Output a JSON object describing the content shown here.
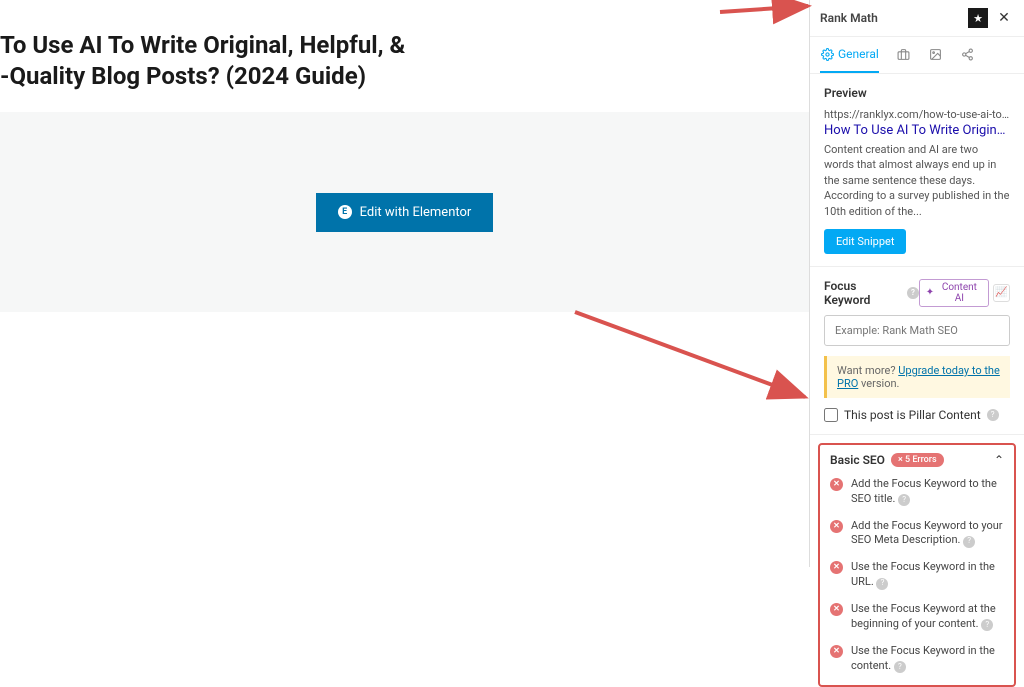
{
  "main": {
    "title_line1": "To Use AI To Write Original, Helpful, &",
    "title_line2": "-Quality Blog Posts? (2024 Guide)",
    "elementor_button": "Edit with Elementor"
  },
  "sidebar": {
    "plugin_name": "Rank Math",
    "tabs": {
      "general": "General"
    },
    "preview": {
      "heading": "Preview",
      "url": "https://ranklyx.com/how-to-use-ai-to-writ...",
      "title": "How To Use AI To Write Original, H...",
      "description": "Content creation and AI are two words that almost always end up in the same sentence these days. According to a survey published in the 10th edition of the...",
      "edit_button": "Edit Snippet"
    },
    "focus_keyword": {
      "label": "Focus Keyword",
      "content_ai": "Content AI",
      "placeholder": "Example: Rank Math SEO"
    },
    "upgrade": {
      "prefix": "Want more? ",
      "link": "Upgrade today to the PRO",
      "suffix": " version."
    },
    "pillar": {
      "label": "This post is Pillar Content"
    },
    "basic_seo": {
      "title": "Basic SEO",
      "error_badge": "× 5 Errors",
      "errors": [
        "Add the Focus Keyword to the SEO title.",
        "Add the Focus Keyword to your SEO Meta Description.",
        "Use the Focus Keyword in the URL.",
        "Use the Focus Keyword at the beginning of your content.",
        "Use the Focus Keyword in the content."
      ]
    }
  }
}
